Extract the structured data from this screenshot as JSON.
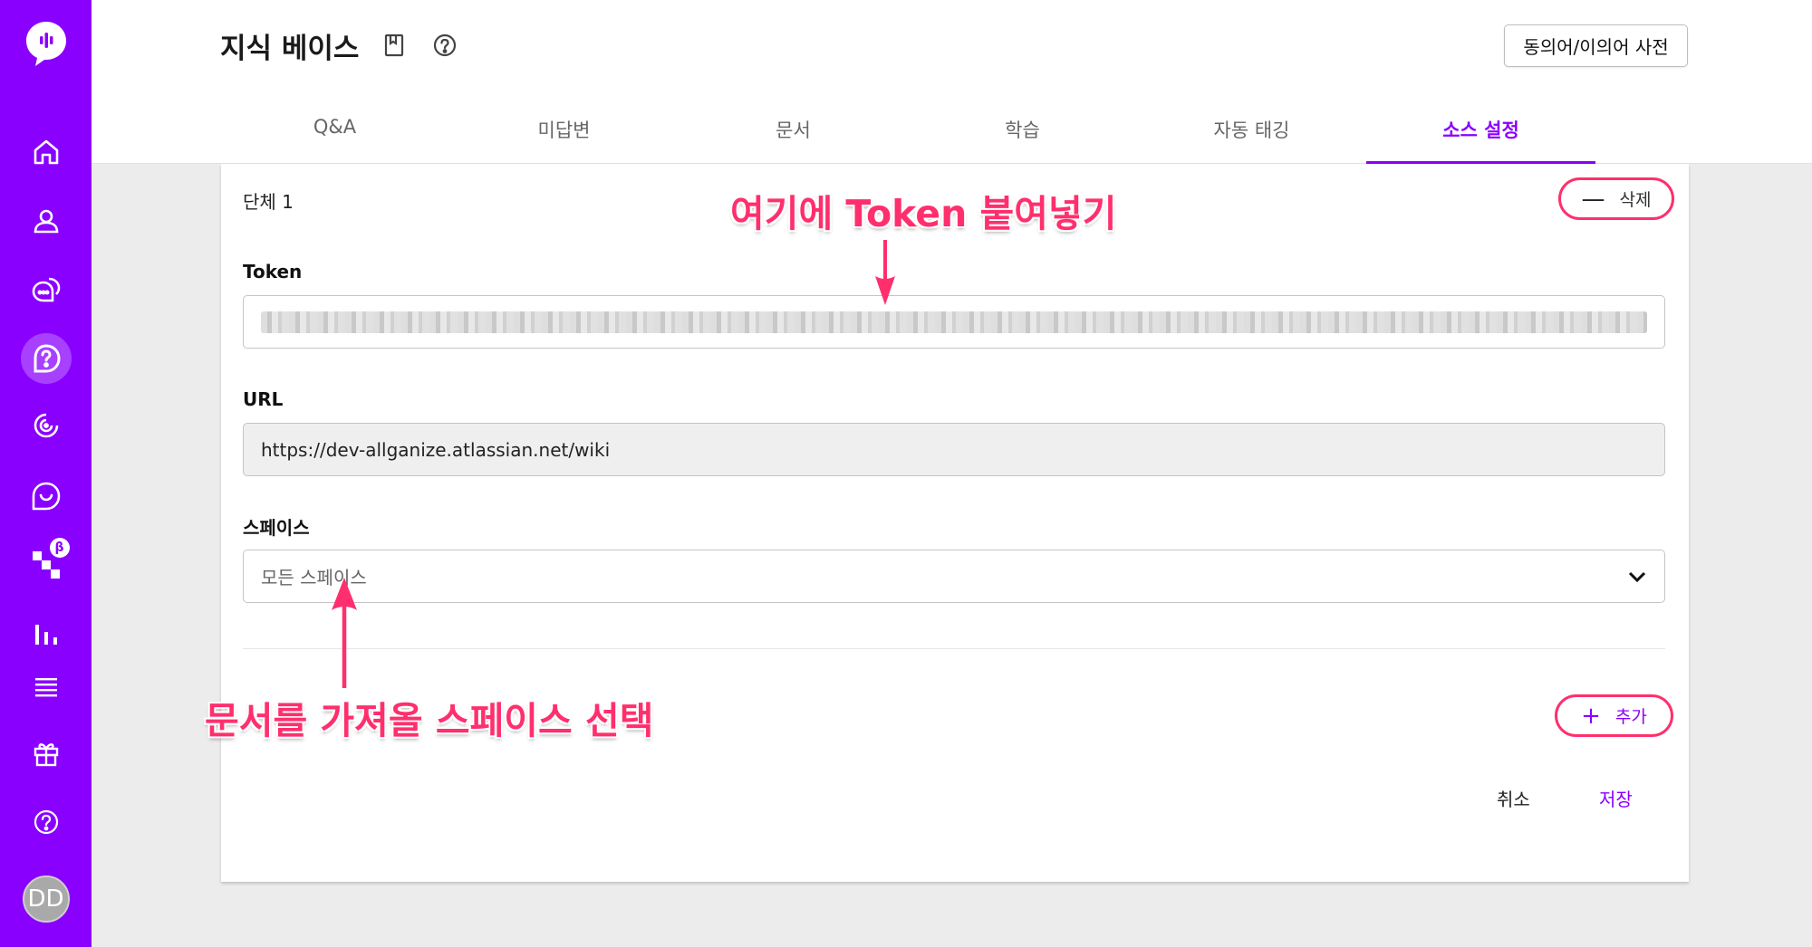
{
  "sidebar": {
    "items": [
      {
        "icon": "home-icon"
      },
      {
        "icon": "user-icon"
      },
      {
        "icon": "chat-bubbles-icon"
      },
      {
        "icon": "question-answer-icon",
        "active": true
      },
      {
        "icon": "target-icon"
      },
      {
        "icon": "chat-icon"
      },
      {
        "icon": "flow-icon",
        "badge": "β"
      },
      {
        "icon": "bar-chart-icon"
      },
      {
        "icon": "list-icon"
      },
      {
        "icon": "gift-icon"
      },
      {
        "icon": "help-icon"
      }
    ],
    "avatar_initials": "DD",
    "accent": "#8a00ff"
  },
  "header": {
    "title": "지식 베이스",
    "dictionary_button": "동의어/이의어 사전",
    "tabs": [
      "Q&A",
      "미답변",
      "문서",
      "학습",
      "자동 태깅",
      "소스 설정"
    ],
    "active_tab": "소스 설정"
  },
  "form": {
    "group_title": "단체 1",
    "delete_button": "삭제",
    "token_label": "Token",
    "url_label": "URL",
    "url_value": "https://dev-allganize.atlassian.net/wiki",
    "space_label": "스페이스",
    "space_value": "모든 스페이스",
    "add_button": "추가",
    "cancel_button": "취소",
    "save_button": "저장"
  },
  "annotations": {
    "token_hint": "여기에 Token 붙여넣기",
    "space_hint": "문서를 가져올 스페이스 선택",
    "color": "#ff2f6d"
  }
}
